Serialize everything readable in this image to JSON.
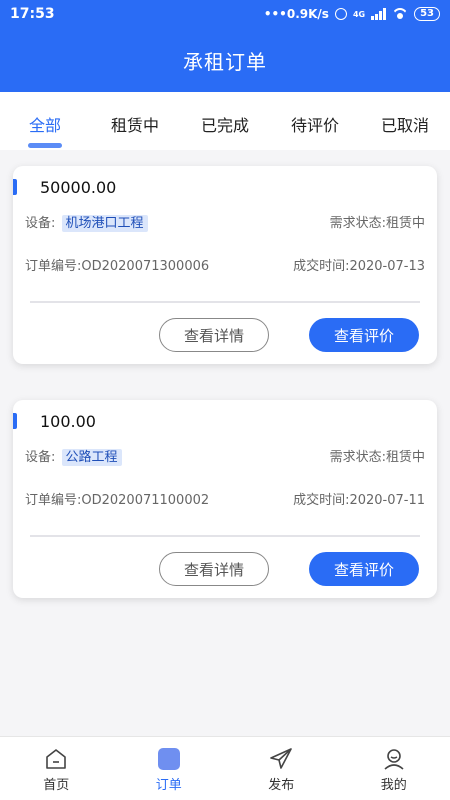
{
  "status_bar": {
    "time": "17:53",
    "network_speed": "•••0.9K/s",
    "signal_label": "4G",
    "battery": "53"
  },
  "header": {
    "title": "承租订单"
  },
  "tabs": [
    {
      "label": "全部",
      "active": true
    },
    {
      "label": "租赁中",
      "active": false
    },
    {
      "label": "已完成",
      "active": false
    },
    {
      "label": "待评价",
      "active": false
    },
    {
      "label": "已取消",
      "active": false
    }
  ],
  "orders": [
    {
      "amount": "50000.00",
      "device_label": "设备:",
      "device": "机场港口工程",
      "status": "需求状态:租赁中",
      "order_no": "订单编号:OD2020071300006",
      "deal_time": "成交时间:2020-07-13",
      "detail_btn": "查看详情",
      "review_btn": "查看评价"
    },
    {
      "amount": "100.00",
      "device_label": "设备:",
      "device": "公路工程",
      "status": "需求状态:租赁中",
      "order_no": "订单编号:OD2020071100002",
      "deal_time": "成交时间:2020-07-11",
      "detail_btn": "查看详情",
      "review_btn": "查看评价"
    }
  ],
  "bottom_nav": [
    {
      "label": "首页",
      "icon": "home-icon",
      "active": false
    },
    {
      "label": "订单",
      "icon": "order-icon",
      "active": true
    },
    {
      "label": "发布",
      "icon": "paper-plane-icon",
      "active": false
    },
    {
      "label": "我的",
      "icon": "user-icon",
      "active": false
    }
  ],
  "colors": {
    "primary": "#2a6cf5",
    "tag_bg": "#dbe6fb",
    "background": "#f5f5f7"
  }
}
